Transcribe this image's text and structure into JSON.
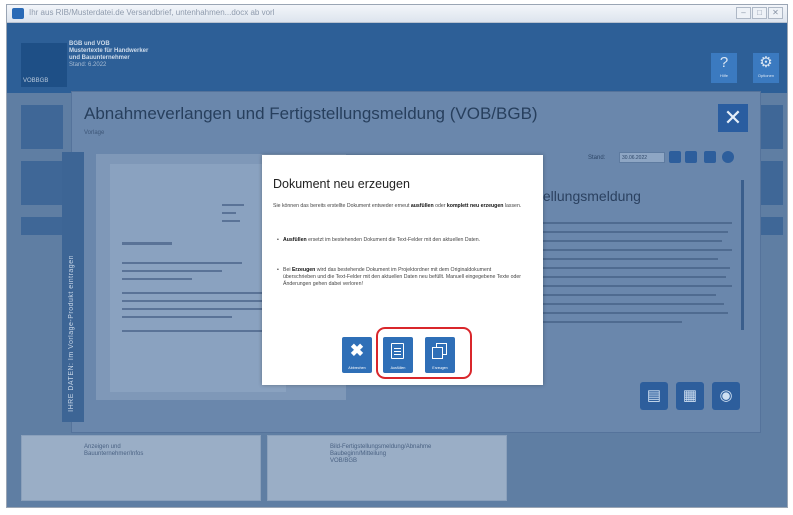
{
  "window": {
    "title": "Ihr aus RIB/Musterdatei.de Versandbrief, untenhahmen...docx ab vorl"
  },
  "window_buttons": [
    "–",
    "□",
    "✕"
  ],
  "app": {
    "name_line1": "BGB und VOB",
    "name_line2": "Mustertexte für Handwerker",
    "name_line3": "und Bauunternehmer",
    "name_line4": "Stand: 6.2022",
    "logo_text": "VOBBGB",
    "help_label": "Hilfe",
    "settings_label": "Optionen"
  },
  "panel": {
    "title": "Abnahmeverlangen und Fertigstellungsmeldung (VOB/BGB)",
    "subtitle": "Vorlage",
    "vertical_tab": "IHRE DATEN: Im Vorlage-Produkt eintragen",
    "stand_label": "Stand:",
    "stand_value": "30.06.2022",
    "right_heading": "stellungsmeldung"
  },
  "background_tiles": [
    {
      "title": "Anzeigen und\nBauunternehmer/Infos"
    },
    {
      "title": "Bild-Fertigstellungsmeldung/Abnahme\nBaubeginn/Mitteilung\nVOB/BGB"
    }
  ],
  "modal": {
    "title": "Dokument neu erzeugen",
    "intro_pre": "Sie können das bereits erstellte Dokument entweder erneut ",
    "intro_b1": "ausfüllen",
    "intro_mid": " oder ",
    "intro_b2": "komplett neu erzeugen",
    "intro_post": " lassen.",
    "bullet1_b": "Ausfüllen",
    "bullet1_rest": " ersetzt im bestehenden Dokument die Text-Felder mit den aktuellen Daten.",
    "bullet2_pre": "Bei ",
    "bullet2_b": "Erzeugen",
    "bullet2_rest": " wird das bestehende Dokument im Projektordner mit dem Originaldokument überschrieben und die Text-Felder mit den aktuellen Daten neu befüllt. Manuell eingegebene Texte oder Änderungen gehen dabei verloren!",
    "buttons": {
      "cancel": "Abbrechen",
      "fill": "Ausfüllen",
      "create": "Erzeugen"
    }
  },
  "colors": {
    "accent": "#2f6fb7",
    "highlight": "#d9262b"
  }
}
